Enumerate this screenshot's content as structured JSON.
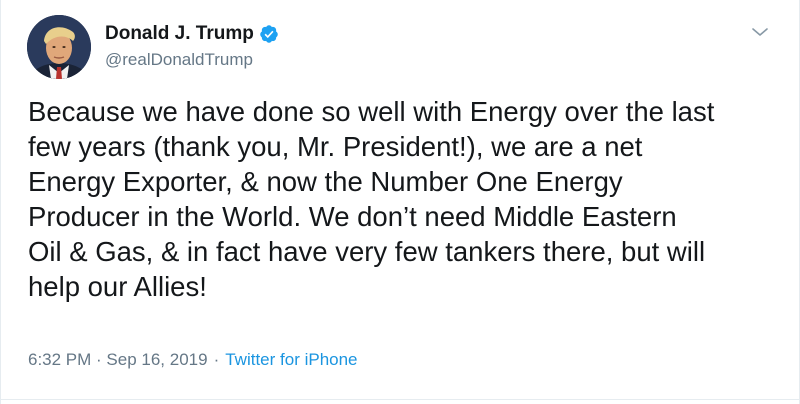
{
  "tweet": {
    "author": {
      "display_name": "Donald J. Trump",
      "handle": "@realDonaldTrump",
      "verified": true,
      "avatar_icon": "profile-photo"
    },
    "text_lines": [
      "Because we have done so well with Energy over the last",
      "few years (thank you, Mr. President!), we are a net",
      "Energy Exporter, & now the Number One Energy",
      "Producer in the World. We don’t need Middle Eastern",
      "Oil & Gas, & in fact have very few tankers there, but will",
      "help our Allies!"
    ],
    "timestamp": "6:32 PM · Sep 16, 2019",
    "separator": "·",
    "source": "Twitter for iPhone",
    "menu_icon": "chevron-down-icon"
  },
  "colors": {
    "text": "#14171a",
    "secondary": "#657786",
    "link": "#1b95e0",
    "verified": "#1da1f2",
    "border": "#e6ecf0"
  }
}
